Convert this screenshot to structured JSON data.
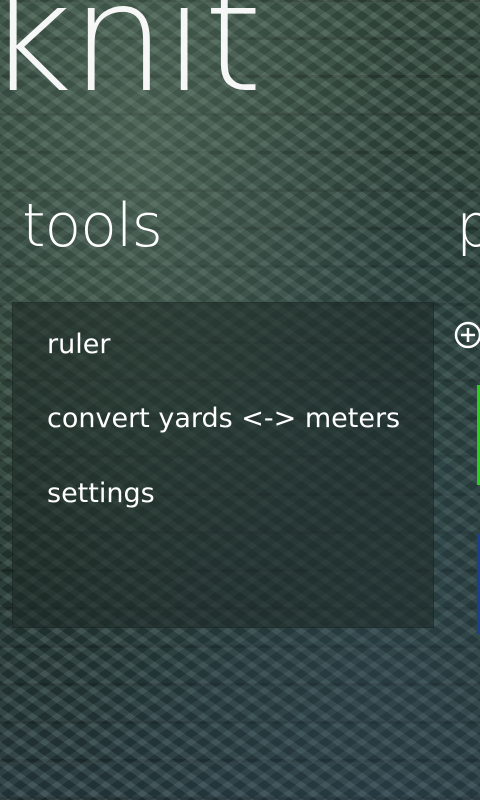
{
  "app": {
    "title": "knit"
  },
  "tools": {
    "title": "tools",
    "items": [
      {
        "label": "ruler"
      },
      {
        "label": "convert yards <-> meters"
      },
      {
        "label": "settings"
      }
    ]
  },
  "next_panel": {
    "title_partial": "p"
  },
  "icons": {
    "add": "add-circle-icon"
  },
  "colors": {
    "tile_green": "#2ecc1f",
    "tile_blue": "#1e3f8f",
    "text": "#ffffff"
  }
}
